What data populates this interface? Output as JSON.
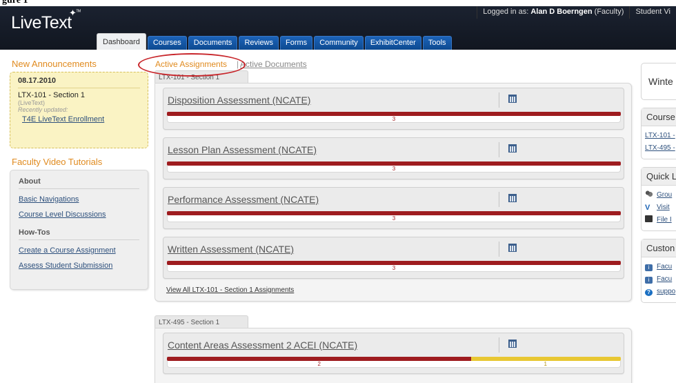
{
  "figure": {
    "caption": "gure 1"
  },
  "header": {
    "logged_in_prefix": "Logged in as:",
    "user_name": "Alan D Boerngen",
    "user_role": "(Faculty)",
    "student_view": "Student Vi",
    "logo": "LiveText",
    "logo_mark": "TM",
    "tabs": [
      {
        "label": "Dashboard",
        "active": true
      },
      {
        "label": "Courses"
      },
      {
        "label": "Documents"
      },
      {
        "label": "Reviews"
      },
      {
        "label": "Forms"
      },
      {
        "label": "Community"
      },
      {
        "label": "ExhibitCenter"
      },
      {
        "label": "Tools"
      }
    ]
  },
  "left": {
    "announcements_title": "New Announcements",
    "announcement": {
      "date": "08.17.2010",
      "course": "LTX-101 - Section 1",
      "source": "(LiveText)",
      "updated": "Recently updated:",
      "link": "T4E LiveText Enrollment"
    },
    "videos_title": "Faculty Video Tutorials",
    "about_head": "About",
    "about_links": [
      "Basic Navigations",
      "Course Level Discussions"
    ],
    "howtos_head": "How-Tos",
    "howto_links": [
      "Create a Course Assignment",
      "Assess Student Submission"
    ]
  },
  "main": {
    "tab_active": "Active Assignments",
    "tab_sep": "|",
    "tab_other": "Active Documents",
    "course1": {
      "name": "LTX-101 - Section 1",
      "assignments": [
        {
          "title": "Disposition Assessment (NCATE)",
          "count": "3"
        },
        {
          "title": "Lesson Plan Assessment (NCATE)",
          "count": "3"
        },
        {
          "title": "Performance Assessment (NCATE)",
          "count": "3"
        },
        {
          "title": "Written Assessment (NCATE)",
          "count": "3"
        }
      ],
      "view_all": "View All LTX-101 - Section 1 Assignments"
    },
    "course2": {
      "name": "LTX-495 - Section 1",
      "assignment": {
        "title": "Content Areas Assessment 2 ACEI (NCATE)",
        "count_red": "2",
        "count_yellow": "1",
        "red_fraction": 0.67
      }
    },
    "colors": {
      "accent": "#e08a1e",
      "bar_red": "#9e1c1f",
      "bar_yellow": "#e8c733",
      "tab_blue": "#1c63b8"
    }
  },
  "right": {
    "term": "Winte",
    "courses_head": "Course",
    "course_links": [
      "LTX-101 -",
      "LTX-495 -"
    ],
    "quick_head": "Quick L",
    "quick_links": [
      {
        "icon": "group-icon",
        "label": "Grou"
      },
      {
        "icon": "vp-icon",
        "label": "Visit"
      },
      {
        "icon": "file-icon",
        "label": "File I"
      }
    ],
    "custom_head": "Custon",
    "custom_links": [
      {
        "icon": "info-icon",
        "label": "Facu"
      },
      {
        "icon": "info-icon",
        "label": "Facu"
      },
      {
        "icon": "help-icon",
        "label": "suppo"
      }
    ]
  }
}
